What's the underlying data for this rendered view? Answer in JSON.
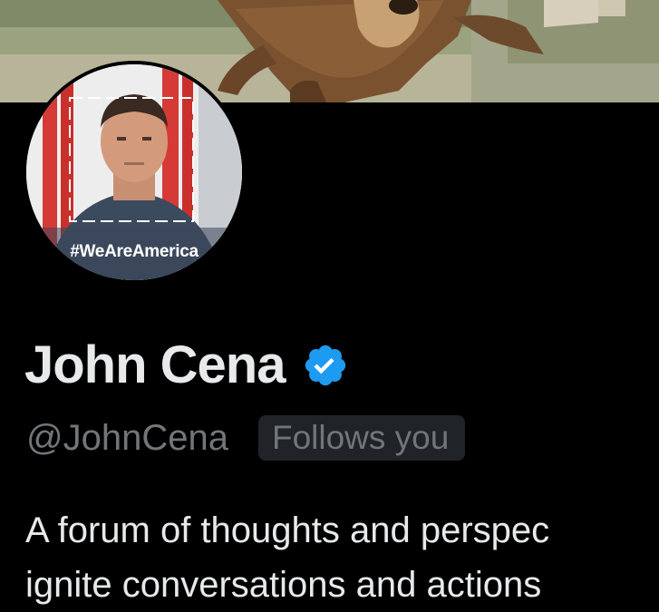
{
  "profile": {
    "display_name": "John Cena",
    "handle": "@JohnCena",
    "follows_you": "Follows you",
    "verified_icon": "verified-badge-icon",
    "verified_color": "#1d9bf0",
    "bio_line1": "A forum of thoughts and perspec",
    "bio_line2": "ignite conversations and actions"
  },
  "avatar": {
    "hashtag": "#WeAreAmerica"
  },
  "colors": {
    "background": "#000000",
    "primary_text": "#e7e9ea",
    "secondary_text": "#71767b",
    "badge_bg": "#202327"
  }
}
